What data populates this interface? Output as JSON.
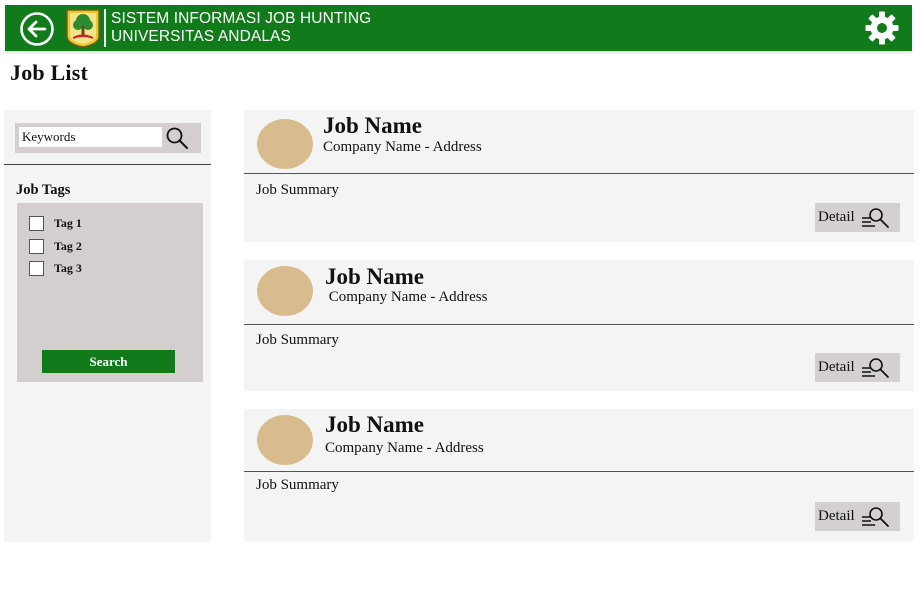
{
  "header": {
    "title_line1": "SISTEM INFORMASI JOB HUNTING",
    "title_line2": "UNIVERSITAS ANDALAS",
    "brand_color": "#117a1a",
    "back_icon": "arrow-left-circle-icon",
    "settings_icon": "gear-icon",
    "logo": "university-logo"
  },
  "page": {
    "title": "Job List"
  },
  "sidebar": {
    "search": {
      "placeholder": "Keywords",
      "value": "",
      "icon": "search-icon"
    },
    "tags_heading": "Job Tags",
    "tags": [
      {
        "label": "Tag 1",
        "checked": false
      },
      {
        "label": "Tag 2",
        "checked": false
      },
      {
        "label": "Tag 3",
        "checked": false
      }
    ],
    "search_button": "Search"
  },
  "jobs": [
    {
      "name": "Job Name",
      "company": "Company Name - Address",
      "summary": "Job Summary",
      "detail_label": "Detail"
    },
    {
      "name": "Job Name",
      "company": " Company Name - Address",
      "summary": "Job Summary",
      "detail_label": "Detail"
    },
    {
      "name": "Job Name",
      "company": "Company Name - Address",
      "summary": "Job Summary",
      "detail_label": "Detail"
    }
  ],
  "colors": {
    "panel": "#f4f4f4",
    "filter_box": "#d4cfce",
    "avatar": "#d8bc8d",
    "detail_button": "#d4d0d0"
  }
}
